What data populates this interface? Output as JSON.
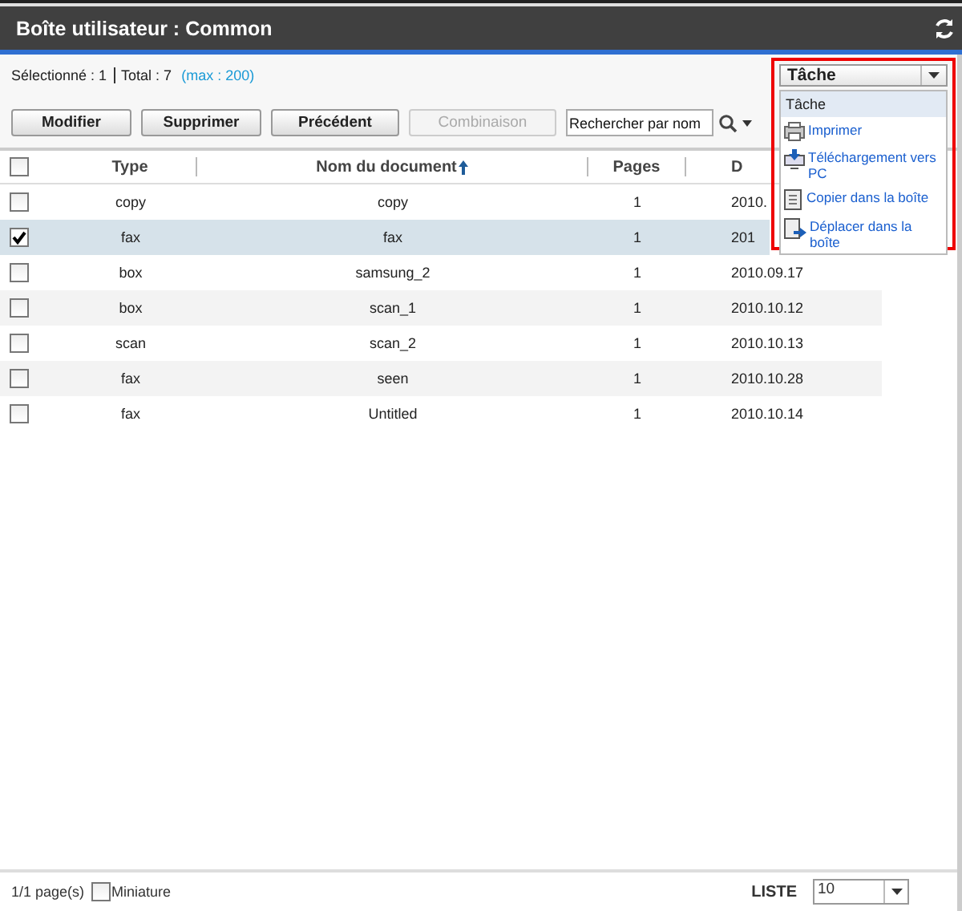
{
  "window": {
    "title": "Boîte utilisateur : Common"
  },
  "summary": {
    "selected": "Sélectionné : 1",
    "total": "Total : 7",
    "max": "(max : 200)"
  },
  "buttons": [
    {
      "label": "Modifier",
      "disabled": false
    },
    {
      "label": "Supprimer",
      "disabled": false
    },
    {
      "label": "Précédent",
      "disabled": false
    },
    {
      "label": "Combinaison",
      "disabled": true
    }
  ],
  "search": {
    "placeholder": "Rechercher par nom"
  },
  "task_menu": {
    "value": "Tâche",
    "header": "Tâche",
    "items": [
      {
        "label": "Imprimer",
        "kind": "print"
      },
      {
        "label": "Téléchargement vers PC",
        "kind": "download"
      },
      {
        "label": "Copier dans la boîte",
        "kind": "copy"
      },
      {
        "label": "Déplacer dans la boîte",
        "kind": "move"
      }
    ]
  },
  "table": {
    "all_checked": false,
    "columns": [
      {
        "label": "Type",
        "sorted": false
      },
      {
        "label": "Nom du document",
        "sorted": true
      },
      {
        "label": "Pages",
        "sorted": false
      },
      {
        "label": "D",
        "sorted": false
      }
    ],
    "rows": [
      {
        "checked": false,
        "cells": [
          "copy",
          "copy",
          "1",
          "2010."
        ]
      },
      {
        "checked": true,
        "cells": [
          "fax",
          "fax",
          "1",
          "201"
        ]
      },
      {
        "checked": false,
        "cells": [
          "box",
          "samsung_2",
          "1",
          "2010.09.17"
        ]
      },
      {
        "checked": false,
        "cells": [
          "box",
          "scan_1",
          "1",
          "2010.10.12"
        ]
      },
      {
        "checked": false,
        "cells": [
          "scan",
          "scan_2",
          "1",
          "2010.10.13"
        ]
      },
      {
        "checked": false,
        "cells": [
          "fax",
          "seen",
          "1",
          "2010.10.28"
        ]
      },
      {
        "checked": false,
        "cells": [
          "fax",
          "Untitled",
          "1",
          "2010.10.14"
        ]
      }
    ]
  },
  "footer": {
    "pages": "1/1 page(s)",
    "thumbnail": {
      "label": "Miniature",
      "checked": false
    },
    "list_label": "LISTE",
    "list_size": "10"
  }
}
